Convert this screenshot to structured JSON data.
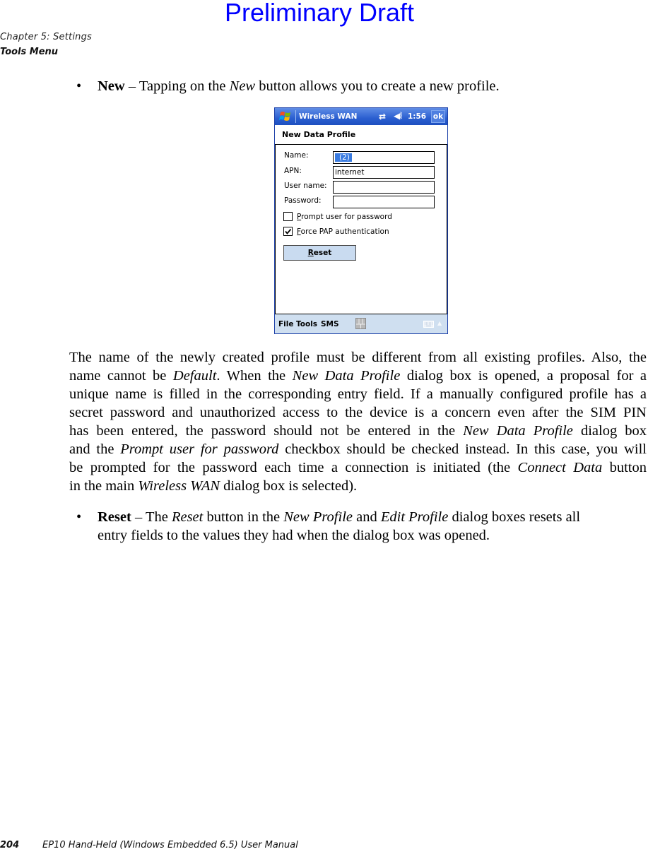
{
  "watermark": "Preliminary Draft",
  "header": {
    "chapter": "Chapter 5:  Settings",
    "section": "Tools Menu"
  },
  "bullets": {
    "new": {
      "bullet": "•",
      "term": "New",
      "dash": " – Tapping on the ",
      "italic": "New",
      "rest": " button allows you to create a new profile."
    },
    "reset": {
      "bullet": "•",
      "term": "Reset",
      "t1": " – The ",
      "i1": "Reset",
      "t2": " button in the ",
      "i2": "New Profile",
      "t3": " and ",
      "i3": "Edit Profile",
      "t4": " dialog boxes resets all",
      "line2": "entry fields to the values they had when the dialog box was opened."
    }
  },
  "paragraph": {
    "l1": "The name of the newly created profile must be different from all existing profiles. Also, the",
    "l2a": "name cannot be ",
    "l2i1": "Default",
    "l2b": ". When the ",
    "l2i2": "New Data Profile",
    "l2c": " dialog box is opened, a proposal for a",
    "l3": "unique name is filled in the corresponding entry field. If a manually configured profile has a",
    "l4": "secret password and unauthorized access to the device is a concern even after the SIM PIN",
    "l5a": "has been entered, the password should not be entered in the ",
    "l5i": "New Data Profile",
    "l5b": " dialog box",
    "l6a": "and the ",
    "l6i": "Prompt user for password",
    "l6b": " checkbox should be checked instead. In this case, you will",
    "l7a": "be prompted for the password each time a connection is initiated (the ",
    "l7i": "Connect Data",
    "l7b": " button",
    "l8a": "in the main ",
    "l8i": "Wireless WAN",
    "l8b": " dialog box is selected)."
  },
  "device": {
    "titlebar": {
      "app_title": "Wireless WAN",
      "connectivity_icon": "⇄",
      "volume_icon": "◀⦚",
      "time": "1:56",
      "ok_label": "ok"
    },
    "dialog_title": "New Data Profile",
    "fields": [
      {
        "label": "Name:",
        "value": "(2)",
        "selected": true
      },
      {
        "label": "APN:",
        "value": "internet"
      },
      {
        "label": "User name:",
        "value": ""
      },
      {
        "label": "Password:",
        "value": ""
      }
    ],
    "checkboxes": [
      {
        "mnemonic": "P",
        "rest": "rompt user for password",
        "checked": false
      },
      {
        "mnemonic": "F",
        "rest": "orce PAP authentication",
        "checked": true
      }
    ],
    "reset_button": {
      "mnemonic": "R",
      "rest": "eset"
    },
    "menubar": {
      "items": [
        "File",
        "Tools",
        "SMS"
      ]
    }
  },
  "footer": {
    "page_number": "204",
    "manual_title": "EP10 Hand-Held (Windows Embedded 6.5) User Manual"
  }
}
